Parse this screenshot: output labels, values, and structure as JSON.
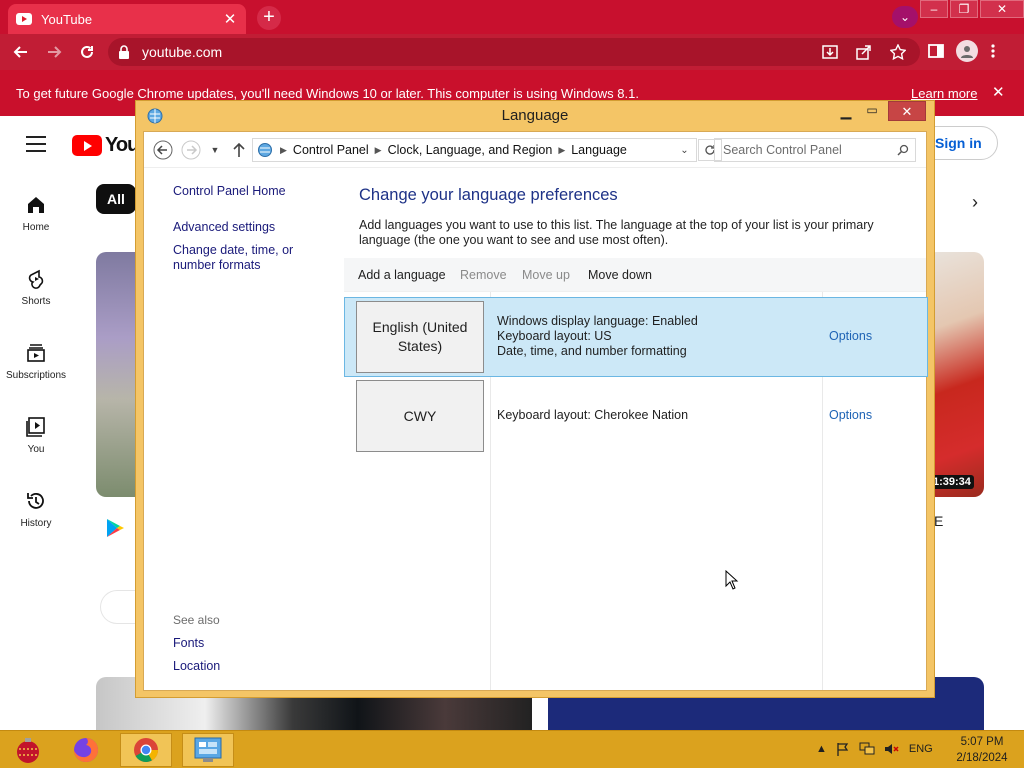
{
  "browser": {
    "tab_title": "YouTube",
    "url": "youtube.com",
    "infobar_message": "To get future Google Chrome updates, you'll need Windows 10 or later. This computer is using Windows 8.1.",
    "infobar_link": "Learn more",
    "theme_color": "#c8102e"
  },
  "youtube": {
    "logo_text": "YouT",
    "sign_in": "Sign in",
    "chip_all": "All",
    "sidebar": [
      {
        "label": "Home",
        "icon": "home-icon"
      },
      {
        "label": "Shorts",
        "icon": "shorts-icon"
      },
      {
        "label": "Subscriptions",
        "icon": "subscriptions-icon"
      },
      {
        "label": "You",
        "icon": "you-icon"
      },
      {
        "label": "History",
        "icon": "history-icon"
      }
    ],
    "video_duration": "1:39:34",
    "partial_title": "E"
  },
  "dialog": {
    "title": "Language",
    "breadcrumb": [
      "Control Panel",
      "Clock, Language, and Region",
      "Language"
    ],
    "search_placeholder": "Search Control Panel",
    "left_nav": {
      "home": "Control Panel Home",
      "advanced": "Advanced settings",
      "change_date": "Change date, time, or number formats",
      "see_also": "See also",
      "fonts": "Fonts",
      "location": "Location"
    },
    "heading": "Change your language preferences",
    "description": "Add languages you want to use to this list. The language at the top of your list is your primary language (the one you want to see and use most often).",
    "commands": {
      "add": "Add a language",
      "remove": "Remove",
      "move_up": "Move up",
      "move_down": "Move down"
    },
    "languages": [
      {
        "name": "English (United States)",
        "lines": [
          "Windows display language: Enabled",
          "Keyboard layout: US",
          "Date, time, and number formatting"
        ],
        "options": "Options",
        "selected": true
      },
      {
        "name": "CWY",
        "lines": [
          "Keyboard layout: Cherokee Nation"
        ],
        "options": "Options",
        "selected": false
      }
    ]
  },
  "taskbar": {
    "lang": "ENG",
    "time": "5:07 PM",
    "date": "2/18/2024",
    "color": "#dba21e"
  }
}
